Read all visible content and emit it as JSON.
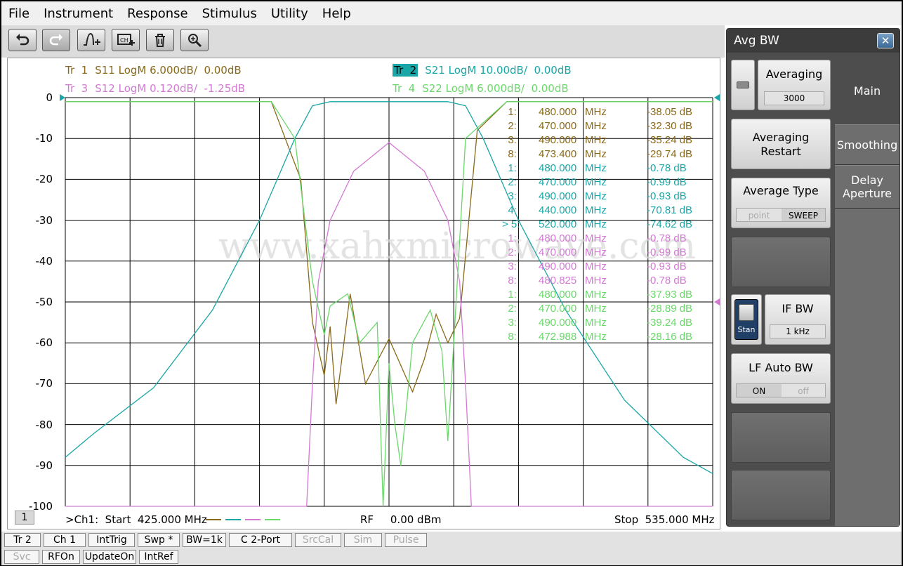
{
  "menu": [
    "File",
    "Instrument",
    "Response",
    "Stimulus",
    "Utility",
    "Help"
  ],
  "toolbar_icons": [
    "undo-icon",
    "redo-icon",
    "marker-add-icon",
    "channel-add-icon",
    "trash-icon",
    "zoom-icon"
  ],
  "traces": [
    {
      "id": "tr1",
      "label": "Tr  1",
      "text": "S11 LogM 6.000dB/  0.00dB",
      "color": "#8a6a1a",
      "highlight": false
    },
    {
      "id": "tr2",
      "label": "Tr  2",
      "text": "S21 LogM 10.00dB/  0.00dB",
      "color": "#1aa6a6",
      "highlight": true
    },
    {
      "id": "tr3",
      "label": "Tr  3",
      "text": "S12 LogM 0.120dB/  -1.25dB",
      "color": "#d27ad2",
      "highlight": false
    },
    {
      "id": "tr4",
      "label": "Tr  4",
      "text": "S22 LogM 6.000dB/  0.00dB",
      "color": "#6ad86a",
      "highlight": false
    }
  ],
  "y_axis": [
    "0",
    "-10",
    "-20",
    "-30",
    "-40",
    "-50",
    "-60",
    "-70",
    "-80",
    "-90",
    "-100"
  ],
  "watermark": "www.xahxmicrowave.com",
  "markers": [
    {
      "prefix": "  1:",
      "freq": "480.000",
      "unit": "MHz",
      "value": "-38.05 dB",
      "color": "#8a6a1a"
    },
    {
      "prefix": "  2:",
      "freq": "470.000",
      "unit": "MHz",
      "value": "-32.30 dB",
      "color": "#8a6a1a"
    },
    {
      "prefix": "  3:",
      "freq": "490.000",
      "unit": "MHz",
      "value": "-35.24 dB",
      "color": "#8a6a1a"
    },
    {
      "prefix": "  8:",
      "freq": "473.400",
      "unit": "MHz",
      "value": "-29.74 dB",
      "color": "#8a6a1a"
    },
    {
      "prefix": "  1:",
      "freq": "480.000",
      "unit": "MHz",
      "value": "-0.78 dB",
      "color": "#1aa6a6"
    },
    {
      "prefix": "  2:",
      "freq": "470.000",
      "unit": "MHz",
      "value": "-0.99 dB",
      "color": "#1aa6a6"
    },
    {
      "prefix": "  3:",
      "freq": "490.000",
      "unit": "MHz",
      "value": "-0.93 dB",
      "color": "#1aa6a6"
    },
    {
      "prefix": "  4:",
      "freq": "440.000",
      "unit": "MHz",
      "value": "-70.81 dB",
      "color": "#1aa6a6"
    },
    {
      "prefix": "> 5:",
      "freq": "520.000",
      "unit": "MHz",
      "value": "-74.62 dB",
      "color": "#1aa6a6"
    },
    {
      "prefix": "  1:",
      "freq": "480.000",
      "unit": "MHz",
      "value": "-0.78 dB",
      "color": "#d27ad2"
    },
    {
      "prefix": "  2:",
      "freq": "470.000",
      "unit": "MHz",
      "value": "-0.99 dB",
      "color": "#d27ad2"
    },
    {
      "prefix": "  3:",
      "freq": "490.000",
      "unit": "MHz",
      "value": "-0.93 dB",
      "color": "#d27ad2"
    },
    {
      "prefix": "  8:",
      "freq": "480.825",
      "unit": "MHz",
      "value": "-0.78 dB",
      "color": "#d27ad2"
    },
    {
      "prefix": "  1:",
      "freq": "480.000",
      "unit": "MHz",
      "value": "-37.93 dB",
      "color": "#6ad86a"
    },
    {
      "prefix": "  2:",
      "freq": "470.000",
      "unit": "MHz",
      "value": "-28.89 dB",
      "color": "#6ad86a"
    },
    {
      "prefix": "  3:",
      "freq": "490.000",
      "unit": "MHz",
      "value": "-39.24 dB",
      "color": "#6ad86a"
    },
    {
      "prefix": "  8:",
      "freq": "472.988",
      "unit": "MHz",
      "value": "-28.16 dB",
      "color": "#6ad86a"
    }
  ],
  "channel_tag": "1",
  "bottom": {
    "start": ">Ch1:  Start  425.000 MHz",
    "rf": "RF     0.00 dBm",
    "stop": "Stop  535.000 MHz"
  },
  "status_row1": [
    {
      "label": "Tr 2",
      "dim": false
    },
    {
      "label": "Ch 1",
      "dim": false
    },
    {
      "label": "IntTrig",
      "dim": false
    },
    {
      "label": "Swp *",
      "dim": false
    },
    {
      "label": "BW=1k",
      "dim": false
    },
    {
      "label": "C  2-Port",
      "dim": false
    },
    {
      "label": "SrcCal",
      "dim": true
    },
    {
      "label": "Sim",
      "dim": true
    },
    {
      "label": "Pulse",
      "dim": true
    }
  ],
  "status_row2": [
    {
      "label": "Svc",
      "dim": true
    },
    {
      "label": "RFOn",
      "dim": false
    },
    {
      "label": "UpdateOn",
      "dim": false
    },
    {
      "label": "IntRef",
      "dim": false
    }
  ],
  "panel": {
    "title": "Avg BW",
    "close": "✕",
    "tabs": [
      "Main",
      "Smoothing",
      "Delay\nAperture"
    ],
    "averaging_label": "Averaging",
    "averaging_value": "3000",
    "restart_label": "Averaging\nRestart",
    "avg_type_label": "Average Type",
    "avg_type_opt1": "point",
    "avg_type_opt2": "SWEEP",
    "ifbw_label": "IF BW",
    "ifbw_value": "1 kHz",
    "stan_label": "Stan",
    "lfauto_label": "LF Auto BW",
    "lfauto_on": "ON",
    "lfauto_off": "off"
  },
  "colors": {
    "s11": "#8a6a1a",
    "s21": "#1aa6a6",
    "s12": "#d27ad2",
    "s22": "#6ad86a"
  },
  "chart_data": {
    "type": "line",
    "xlim": [
      425,
      535
    ],
    "ylim": [
      -100,
      0
    ],
    "grid": true,
    "series": [
      {
        "name": "S11",
        "x": [
          425,
          440,
          460,
          465,
          467,
          469,
          470,
          471,
          473.4,
          476,
          480,
          484,
          486,
          488,
          490,
          492,
          495,
          500,
          535
        ],
        "y": [
          -1,
          -1,
          -1,
          -20,
          -55,
          -68,
          -56,
          -75,
          -48,
          -70,
          -59,
          -72,
          -64,
          -53,
          -60,
          -54,
          -8,
          -1,
          -1
        ]
      },
      {
        "name": "S21",
        "x": [
          425,
          430,
          440,
          450,
          458,
          464,
          467,
          470,
          480,
          490,
          493,
          496,
          502,
          510,
          520,
          530,
          535
        ],
        "y": [
          -88,
          -82,
          -71,
          -52,
          -30,
          -10,
          -2,
          -1,
          -1,
          -1,
          -2,
          -10,
          -30,
          -52,
          -74,
          -88,
          -92
        ]
      },
      {
        "name": "S12",
        "x": [
          425,
          466,
          467,
          468,
          470,
          474,
          480,
          486,
          490,
          492,
          493,
          494,
          535
        ],
        "y": [
          -100,
          -100,
          -70,
          -45,
          -30,
          -18,
          -11,
          -18,
          -30,
          -45,
          -70,
          -100,
          -100
        ]
      },
      {
        "name": "S22",
        "x": [
          425,
          460,
          464,
          467,
          469,
          470,
          472.988,
          475,
          478,
          479,
          480,
          481,
          482,
          484,
          487,
          489,
          490,
          491,
          493,
          500,
          535
        ],
        "y": [
          -1,
          -1,
          -10,
          -45,
          -58,
          -51,
          -48,
          -60,
          -55,
          -100,
          -65,
          -80,
          -90,
          -60,
          -52,
          -62,
          -84,
          -60,
          -10,
          -1,
          -1
        ]
      }
    ]
  }
}
